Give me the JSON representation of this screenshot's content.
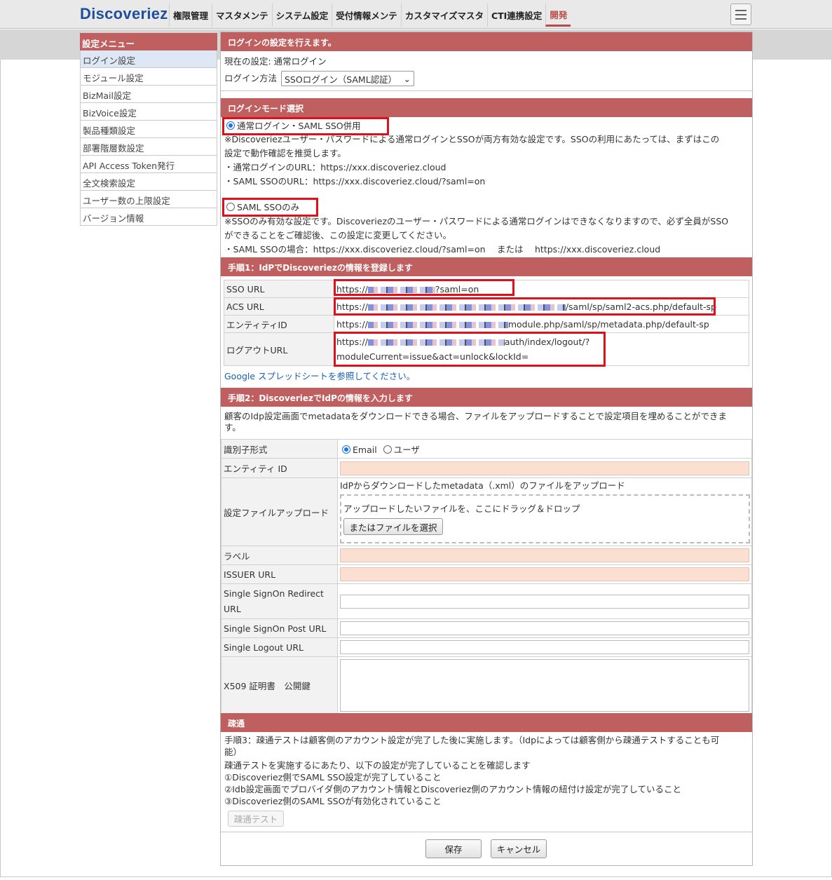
{
  "logo": "Discoveriez",
  "nav": [
    {
      "label": "権限管理"
    },
    {
      "label": "マスタメンテ"
    },
    {
      "label": "システム設定"
    },
    {
      "label": "受付情報メンテ"
    },
    {
      "label": "カスタマイズマスタ"
    },
    {
      "label": "CTI連携設定"
    },
    {
      "label": "開発"
    }
  ],
  "sidebar": {
    "title": "設定メニュー",
    "items": [
      {
        "label": "ログイン設定"
      },
      {
        "label": "モジュール設定"
      },
      {
        "label": "BizMail設定"
      },
      {
        "label": "BizVoice設定"
      },
      {
        "label": "製品種類設定"
      },
      {
        "label": "部署階層数設定"
      },
      {
        "label": "API Access Token発行"
      },
      {
        "label": "全文検索設定"
      },
      {
        "label": "ユーザー数の上限設定"
      },
      {
        "label": "バージョン情報"
      }
    ]
  },
  "login": {
    "header": "ログインの設定を行えます。",
    "current": "現在の設定: 通常ログイン",
    "method_label": "ログイン方法",
    "method_value": "SSOログイン（SAML認証）"
  },
  "mode": {
    "header": "ログインモード選択",
    "opt1_label": "通常ログイン・SAML SSO併用",
    "opt1_desc1": "※Discoveriezユーザー・パスワードによる通常ログインとSSOが両方有効な設定です。SSOの利用にあたっては、まずはこの",
    "opt1_desc2": "設定で動作確認を推奨します。",
    "opt1_url1": "・通常ログインのURL：https://xxx.discoveriez.cloud",
    "opt1_url2": "・SAML SSOのURL：https://xxx.discoveriez.cloud/?saml=on",
    "opt2_label": "SAML SSOのみ",
    "opt2_desc1": "※SSOのみ有効な設定です。Discoveriezのユーザー・パスワードによる通常ログインはできなくなりますので、必ず全員がSSO",
    "opt2_desc2": "ができることをご確認後、この設定に変更してください。",
    "opt2_url": "・SAML SSOの場合：https://xxx.discoveriez.cloud/?saml=on　 または　 https://xxx.discoveriez.cloud"
  },
  "step1": {
    "header": "手順1：IdPでDiscoveriezの情報を登録します",
    "rows": [
      {
        "key": "SSO URL",
        "pre": "https://",
        "post": "?saml=on"
      },
      {
        "key": "ACS URL",
        "pre": "https://",
        "post": "/saml/sp/saml2-acs.php/default-sp"
      },
      {
        "key": "エンティティID",
        "pre": "https://",
        "post": "module.php/saml/sp/metadata.php/default-sp"
      },
      {
        "key": "ログアウトURL",
        "pre": "https://",
        "post": "auth/index/logout/?",
        "line2": "moduleCurrent=issue&act=unlock&lockId="
      }
    ],
    "link": "Google スプレッドシートを参照してください。"
  },
  "step2": {
    "header": "手順2：DiscoveriezでIdPの情報を入力します",
    "desc1": "顧客のIdp設定画面でmetadataをダウンロードできる場合、ファイルをアップロードすることで設定項目を埋めることができま",
    "desc2": "す。",
    "id_format_label": "識別子形式",
    "id_opt1": "Email",
    "id_opt2": "ユーザ",
    "entity_label": "エンティティ ID",
    "upload_label": "設定ファイルアップロード",
    "upload_desc": "IdPからダウンロードしたmetadata（.xml）のファイルをアップロード",
    "drop_text": "アップロードしたいファイルを、ここにドラッグ＆ドロップ",
    "choose_btn": "またはファイルを選択",
    "label_label": "ラベル",
    "issuer_label": "ISSUER URL",
    "redirect_label1": "Single SignOn Redirect",
    "redirect_label2": "URL",
    "post_label": "Single SignOn Post URL",
    "logout_label": "Single Logout URL",
    "x509_label": "X509 証明書　公開鍵"
  },
  "conn": {
    "header": "疎通",
    "line1": "手順3：疎通テストは顧客側のアカウント設定が完了した後に実施します。（Idpによっては顧客側から疎通テストすることも可",
    "line2": "能）",
    "line3": "疎通テストを実施するにあたり、以下の設定が完了していることを確認します",
    "line4": "①Discoveriez側でSAML SSO設定が完了していること",
    "line5": "②Idb設定画面でプロバイダ側のアカウント情報とDiscoveriez側のアカウント情報の紐付け設定が完了していること",
    "line6": "③Discoveriez側のSAML SSOが有効化されていること",
    "test_btn": "疎通テスト"
  },
  "footer": {
    "save": "保存",
    "cancel": "キャンセル"
  },
  "colors": {
    "header": "#bf5f5f",
    "highlight": "#e0101a",
    "required": "#fbe0d2"
  }
}
